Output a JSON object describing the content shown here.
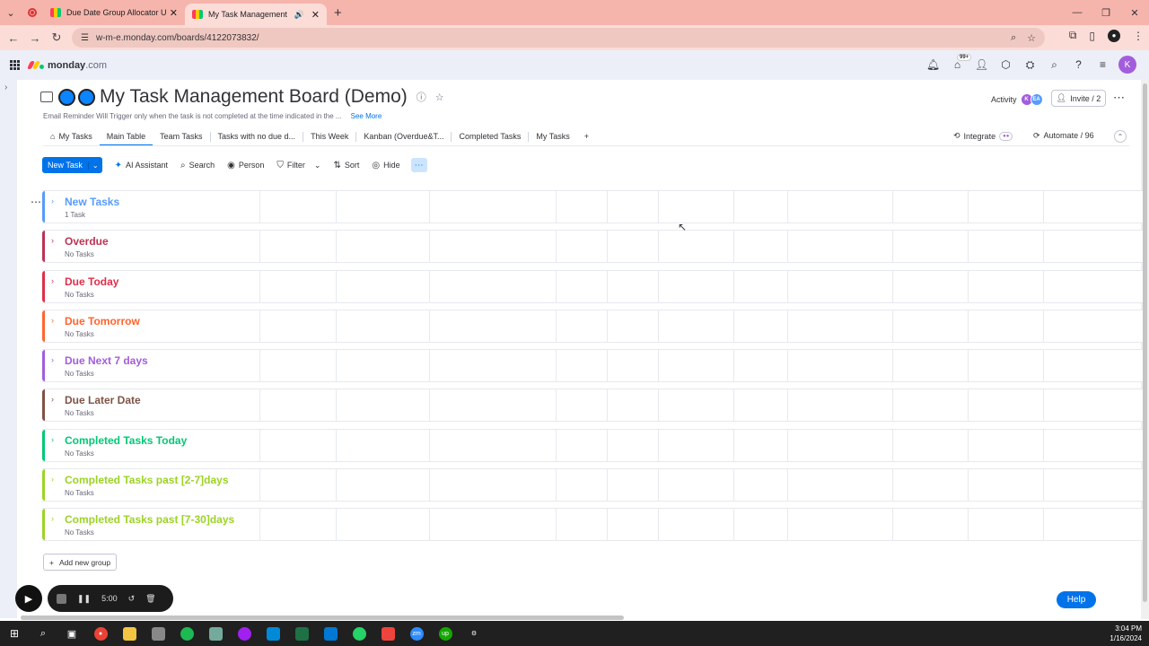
{
  "browser": {
    "tabs": [
      {
        "title": "Due Date Group Allocator User"
      },
      {
        "title": "My Task Management"
      }
    ],
    "url": "w-m-e.monday.com/boards/4122073832/"
  },
  "app": {
    "logo_text": "monday",
    "logo_suffix": ".com",
    "notif_badge": "99+",
    "avatar_letter": "K"
  },
  "board": {
    "title": "My Task Management Board (Demo)",
    "description": "Email Reminder Will Trigger only when the task is not completed at the time indicated in the ...",
    "see_more": "See More",
    "activity_label": "Activity",
    "activity_avatars": [
      "K",
      "EA"
    ],
    "invite_label": "Invite / 2",
    "views": [
      {
        "label": "My Tasks",
        "icon": "home-icon"
      },
      {
        "label": "Main Table",
        "selected": true
      },
      {
        "label": "Team Tasks"
      },
      {
        "label": "Tasks with no due d..."
      },
      {
        "label": "This Week"
      },
      {
        "label": "Kanban (Overdue&T..."
      },
      {
        "label": "Completed Tasks"
      },
      {
        "label": "My Tasks"
      }
    ],
    "integrate_label": "Integrate",
    "automate_label": "Automate / 96"
  },
  "toolbar": {
    "new_task": "New Task",
    "ai_assistant": "AI Assistant",
    "search": "Search",
    "person": "Person",
    "filter": "Filter",
    "sort": "Sort",
    "hide": "Hide"
  },
  "groups": [
    {
      "name": "New Tasks",
      "count": "1 Task",
      "color": "#579bfc"
    },
    {
      "name": "Overdue",
      "count": "No Tasks",
      "color": "#bb3354"
    },
    {
      "name": "Due Today",
      "count": "No Tasks",
      "color": "#df2f4a"
    },
    {
      "name": "Due Tomorrow",
      "count": "No Tasks",
      "color": "#ff642e"
    },
    {
      "name": "Due Next 7 days",
      "count": "No Tasks",
      "color": "#a25ddc"
    },
    {
      "name": "Due Later Date",
      "count": "No Tasks",
      "color": "#7f5347"
    },
    {
      "name": "Completed Tasks Today",
      "count": "No Tasks",
      "color": "#00c875"
    },
    {
      "name": "Completed Tasks past [2-7]days",
      "count": "No Tasks",
      "color": "#9cd326"
    },
    {
      "name": "Completed Tasks past [7-30]days",
      "count": "No Tasks",
      "color": "#9cd326"
    }
  ],
  "add_group": "Add new group",
  "help": "Help",
  "recorder": {
    "time": "5:00"
  },
  "taskbar": {
    "time": "3:04 PM",
    "date": "1/16/2024"
  }
}
